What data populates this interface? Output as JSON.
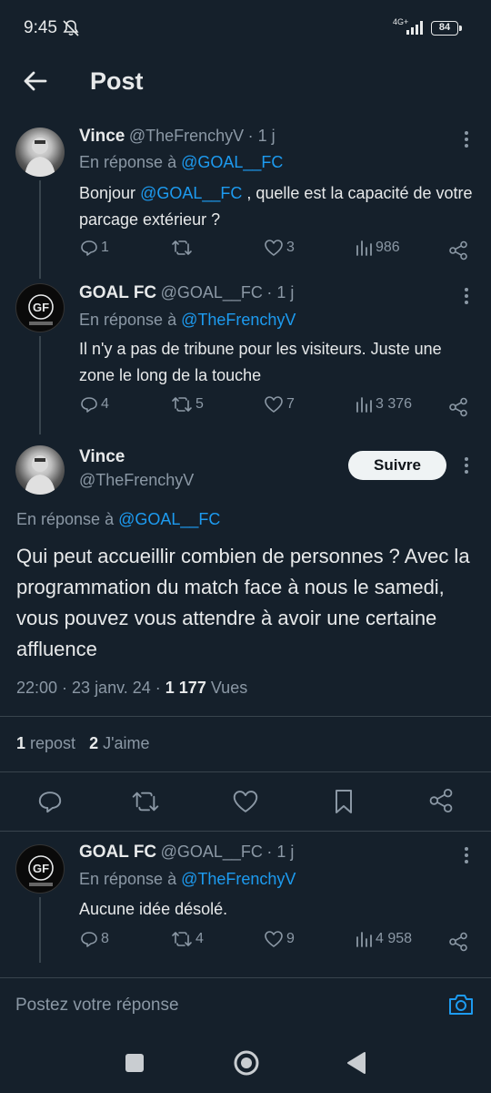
{
  "status_bar": {
    "time": "9:45",
    "network": "4G+",
    "battery": "84"
  },
  "header": {
    "title": "Post"
  },
  "tweets": [
    {
      "name": "Vince",
      "handle": "@TheFrenchyV",
      "time": "· 1 j",
      "reply_prefix": "En réponse à",
      "reply_to": "@GOAL__FC",
      "text_mention": "@GOAL__FC",
      "text_before": "Bonjour",
      "text_after": ", quelle est la capacité de votre parcage extérieur ?",
      "replies": "1",
      "reposts": "",
      "likes": "3",
      "views": "986"
    },
    {
      "name": "GOAL FC",
      "handle": "@GOAL__FC",
      "time": "· 1 j",
      "reply_prefix": "En réponse à",
      "reply_to": "@TheFrenchyV",
      "text": "Il n'y a pas de tribune pour les visiteurs. Juste une zone le long de la touche",
      "replies": "4",
      "reposts": "5",
      "likes": "7",
      "views": "3 376"
    }
  ],
  "main_tweet": {
    "name": "Vince",
    "handle": "@TheFrenchyV",
    "follow_label": "Suivre",
    "reply_prefix": "En réponse à",
    "reply_to": "@GOAL__FC",
    "text": "Qui peut accueillir combien de personnes ? Avec la programmation du match face à nous le samedi, vous pouvez vous attendre à avoir une certaine affluence",
    "datetime": "22:00 · 23 janv. 24 ·",
    "views_count": "1 177",
    "views_label": "Vues",
    "repost_count": "1",
    "repost_label": "repost",
    "like_count": "2",
    "like_label": "J'aime"
  },
  "reply_tweet": {
    "name": "GOAL FC",
    "handle": "@GOAL__FC",
    "time": "· 1 j",
    "reply_prefix": "En réponse à",
    "reply_to": "@TheFrenchyV",
    "text": "Aucune idée désolé.",
    "replies": "8",
    "reposts": "4",
    "likes": "9",
    "views": "4 958"
  },
  "composer": {
    "placeholder": "Postez votre réponse"
  },
  "icons": {
    "back": "arrow-left-icon",
    "more": "more-vertical-icon",
    "reply": "reply-icon",
    "repost": "repost-icon",
    "like": "heart-icon",
    "views": "views-icon",
    "share": "share-icon",
    "bookmark": "bookmark-icon",
    "camera": "camera-icon"
  },
  "colors": {
    "background": "#15202b",
    "accent": "#1d9bf0",
    "muted": "#8b98a5",
    "text": "#e7e9ea"
  }
}
